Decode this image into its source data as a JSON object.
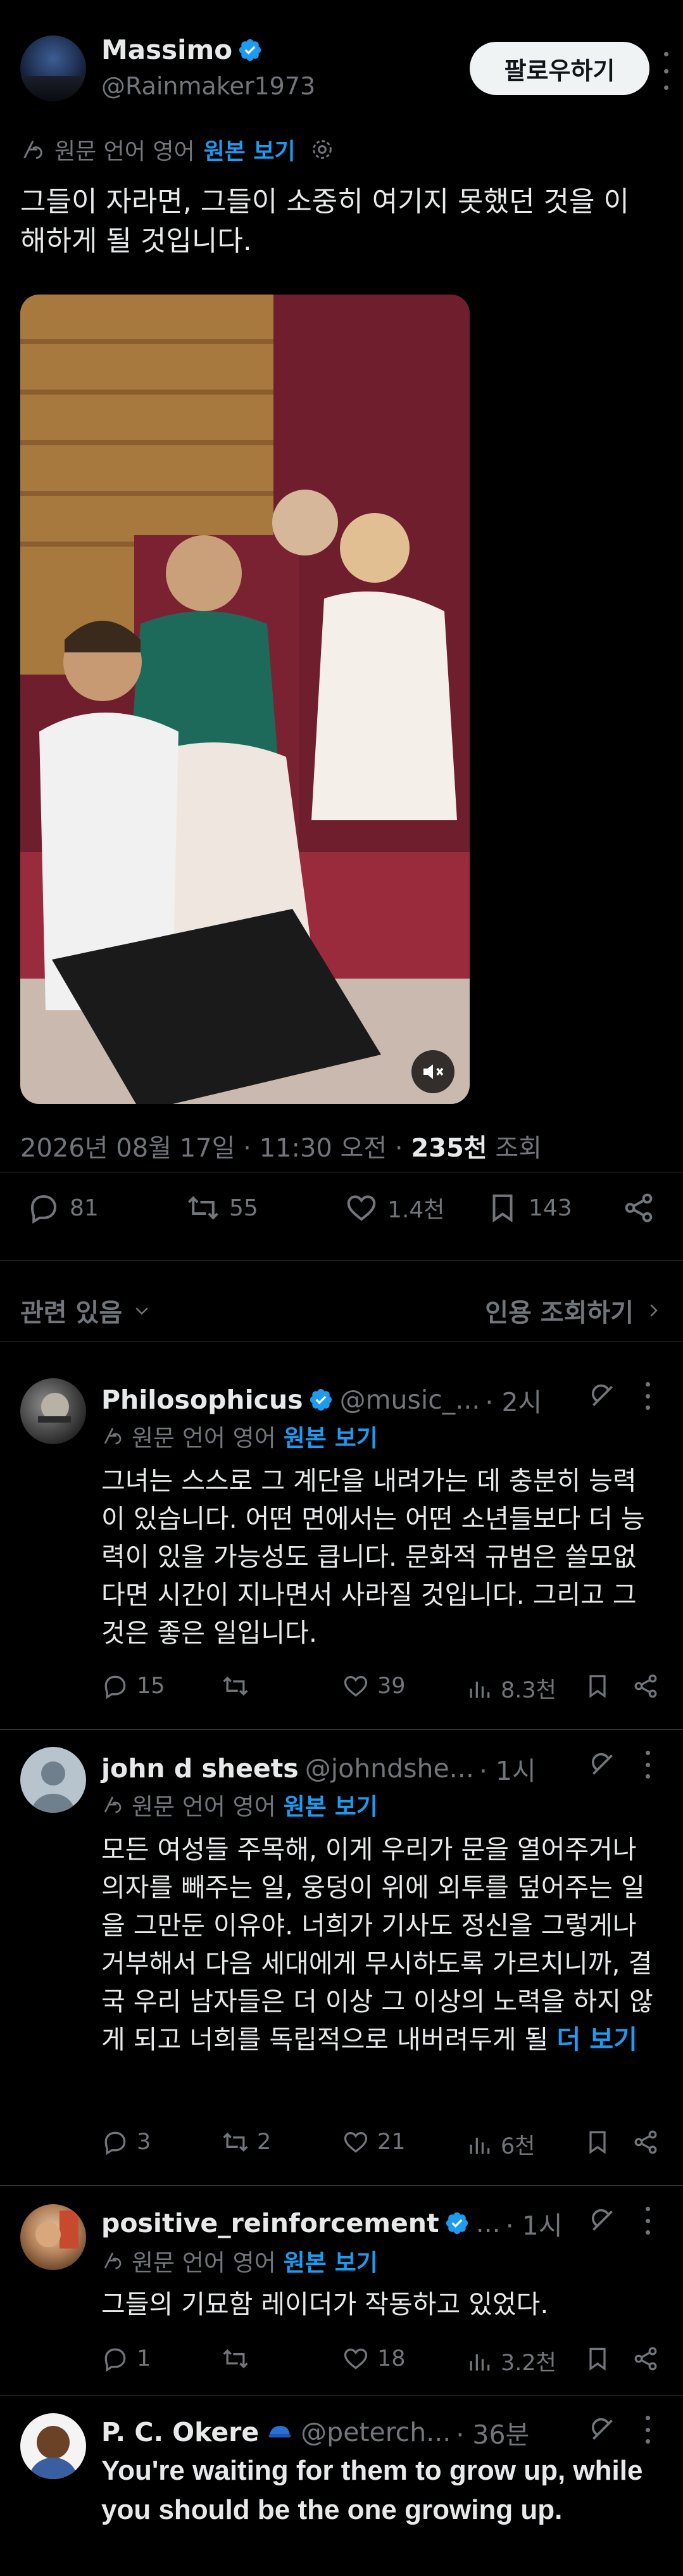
{
  "main_tweet": {
    "author_name": "Massimo",
    "author_handle": "@Rainmaker1973",
    "follow_label": "팔로우하기",
    "language_note": "원문 언어 영어",
    "view_original": "원본 보기",
    "text": "그들이 자라면, 그들이 소중히 여기지 못했던 것을 이해하게 될 것입니다.",
    "timestamp": "2026년 08월 17일 · 11:30 오전 · ",
    "views_count": "235천",
    "views_label": " 조회",
    "replies": "81",
    "reposts": "55",
    "likes": "1.4천",
    "bookmarks": "143"
  },
  "related_label": "관련 있음",
  "quotes_label": "인용 조회하기",
  "replies": [
    {
      "name": "Philosophicus",
      "verified": true,
      "handle": "@music_...",
      "time": "· 2시",
      "language_note": "원문 언어 영어",
      "view_original": "원본 보기",
      "text": "그녀는 스스로 그 계단을 내려가는 데 충분히 능력이 있습니다. 어떤 면에서는 어떤 소년들보다 더 능력이 있을 가능성도 큽니다. 문화적 규범은 쓸모없다면 시간이 지나면서 사라질 것입니다. 그리고 그것은 좋은 일입니다.",
      "more": "",
      "reply_count": "15",
      "repost_count": "",
      "like_count": "39",
      "view_count": "8.3천"
    },
    {
      "name": "john d sheets",
      "verified": false,
      "handle": "@johndshe...",
      "time": "· 1시",
      "language_note": "원문 언어 영어",
      "view_original": "원본 보기",
      "text": "모든 여성들 주목해, 이게 우리가 문을 열어주거나 의자를 빼주는 일, 웅덩이 위에 외투를 덮어주는 일을 그만둔 이유야. 너희가 기사도 정신을 그렇게나 거부해서 다음 세대에게 무시하도록 가르치니까, 결국 우리 남자들은 더 이상 그 이상의 노력을 하지 않게 되고 너희를 독립적으로 내버려두게 될 ",
      "more": "더 보기",
      "reply_count": "3",
      "repost_count": "2",
      "like_count": "21",
      "view_count": "6천"
    },
    {
      "name": "positive_reinforcement",
      "verified": true,
      "handle": "...",
      "time": "· 1시",
      "language_note": "원문 언어 영어",
      "view_original": "원본 보기",
      "text": "그들의 기묘함 레이더가 작동하고 있었다.",
      "more": "",
      "reply_count": "1",
      "repost_count": "",
      "like_count": "18",
      "view_count": "3.2천"
    },
    {
      "name": "P. C. Okere",
      "verified": false,
      "handle": "@peterch...",
      "time": "· 36분",
      "text": "You're waiting for them to grow up, while you should be the one growing up."
    }
  ],
  "colors": {
    "background": "#000000",
    "text": "#e7e9ea",
    "muted": "#71767b",
    "accent": "#1d9bf0",
    "divider": "#2f3336"
  }
}
